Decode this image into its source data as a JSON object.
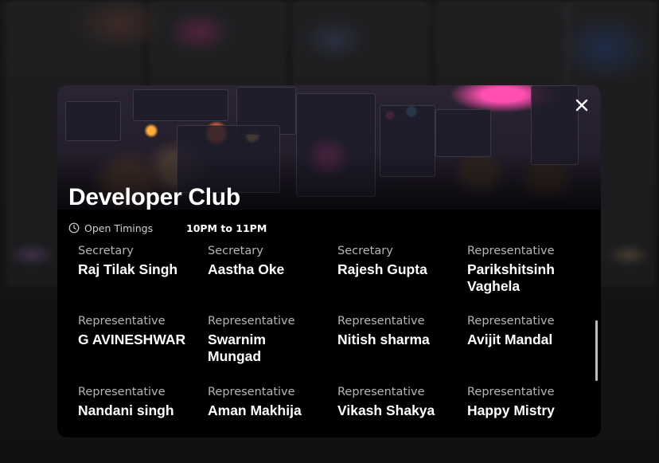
{
  "club": {
    "title": "Developer Club",
    "timings_label": "Open Timings",
    "timings_value": "10PM to 11PM"
  },
  "icons": {
    "close": "close-icon",
    "clock": "clock-icon"
  },
  "members": [
    {
      "role": "Secretary",
      "name": "Raj Tilak Singh"
    },
    {
      "role": "Secretary",
      "name": "Aastha Oke"
    },
    {
      "role": "Secretary",
      "name": "Rajesh Gupta"
    },
    {
      "role": "Representative",
      "name": "Parikshitsinh Vaghela"
    },
    {
      "role": "Representative",
      "name": "G AVINESHWAR"
    },
    {
      "role": "Representative",
      "name": "Swarnim Mungad"
    },
    {
      "role": "Representative",
      "name": "Nitish sharma"
    },
    {
      "role": "Representative",
      "name": "Avijit Mandal"
    },
    {
      "role": "Representative",
      "name": "Nandani singh"
    },
    {
      "role": "Representative",
      "name": "Aman Makhija"
    },
    {
      "role": "Representative",
      "name": "Vikash Shakya"
    },
    {
      "role": "Representative",
      "name": "Happy Mistry"
    }
  ]
}
